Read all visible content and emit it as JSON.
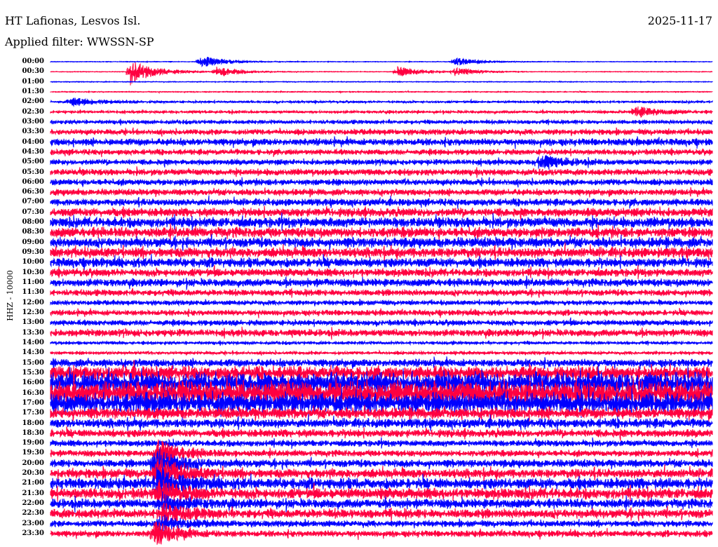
{
  "header": {
    "station": "HT Lafionas, Lesvos Isl.",
    "date": "2025-11-17",
    "filter": "Applied filter: WWSSN-SP"
  },
  "chart_data": {
    "type": "line",
    "title": "HT Lafionas, Lesvos Isl.",
    "ylabel": "HHZ - 10000",
    "row_labels": [
      "00:00",
      "00:30",
      "01:00",
      "01:30",
      "02:00",
      "02:30",
      "03:00",
      "03:30",
      "04:00",
      "04:30",
      "05:00",
      "05:30",
      "06:00",
      "06:30",
      "07:00",
      "07:30",
      "08:00",
      "08:30",
      "09:00",
      "09:30",
      "10:00",
      "10:30",
      "11:00",
      "11:30",
      "12:00",
      "12:30",
      "13:00",
      "13:30",
      "14:00",
      "14:30",
      "15:00",
      "15:30",
      "16:00",
      "16:30",
      "17:00",
      "17:30",
      "18:00",
      "18:30",
      "19:00",
      "19:30",
      "20:00",
      "20:30",
      "21:00",
      "21:30",
      "22:00",
      "22:30",
      "23:00",
      "23:30"
    ],
    "row_minutes": 30,
    "relative_noise_amplitude": [
      0.5,
      0.5,
      0.6,
      0.7,
      1.5,
      1.8,
      2.5,
      3.5,
      4.5,
      3.5,
      3.5,
      4,
      4,
      4,
      4.5,
      5.5,
      6.5,
      6.5,
      6.5,
      6.5,
      6,
      5,
      5,
      4,
      3,
      3.5,
      3.5,
      4.5,
      2,
      2,
      5,
      9,
      14,
      16,
      14,
      7,
      6,
      5,
      4,
      4,
      5,
      6,
      7,
      7,
      6,
      6,
      4,
      4
    ],
    "events": [
      {
        "row": 0,
        "minute": 6.8,
        "amp": 8
      },
      {
        "row": 0,
        "minute": 18.3,
        "amp": 5
      },
      {
        "row": 1,
        "minute": 3.6,
        "amp": 18
      },
      {
        "row": 1,
        "minute": 7.5,
        "amp": 6
      },
      {
        "row": 1,
        "minute": 15.7,
        "amp": 7
      },
      {
        "row": 1,
        "minute": 18.3,
        "amp": 5
      },
      {
        "row": 4,
        "minute": 0.9,
        "amp": 5
      },
      {
        "row": 5,
        "minute": 26.5,
        "amp": 7
      },
      {
        "row": 10,
        "minute": 22.1,
        "amp": 9
      },
      {
        "row": 39,
        "minute": 4.8,
        "amp": 18
      },
      {
        "row": 40,
        "minute": 4.7,
        "amp": 20
      },
      {
        "row": 41,
        "minute": 4.8,
        "amp": 22
      },
      {
        "row": 42,
        "minute": 4.8,
        "amp": 18
      },
      {
        "row": 43,
        "minute": 4.9,
        "amp": 14
      },
      {
        "row": 44,
        "minute": 5,
        "amp": 12
      },
      {
        "row": 45,
        "minute": 5,
        "amp": 12
      },
      {
        "row": 46,
        "minute": 4.9,
        "amp": 10
      },
      {
        "row": 47,
        "minute": 4.7,
        "amp": 14
      }
    ],
    "colors": {
      "even": "#0000ff",
      "odd": "#ff0040"
    }
  }
}
